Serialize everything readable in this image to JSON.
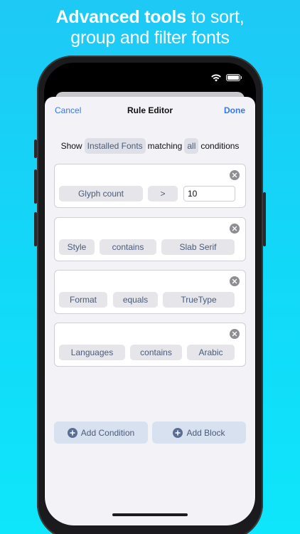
{
  "headline": {
    "bold": "Advanced tools",
    "rest_line1": " to sort,",
    "line2": "group and filter fonts"
  },
  "navbar": {
    "cancel": "Cancel",
    "title": "Rule Editor",
    "done": "Done"
  },
  "match": {
    "show": "Show",
    "scope": "Installed Fonts",
    "matching": "matching",
    "quantifier": "all",
    "conditions": "conditions"
  },
  "rules": [
    {
      "field": "Glyph count",
      "operator": ">",
      "value": "10"
    },
    {
      "field": "Style",
      "operator": "contains",
      "value": "Slab Serif"
    },
    {
      "field": "Format",
      "operator": "equals",
      "value": "TrueType"
    },
    {
      "field": "Languages",
      "operator": "contains",
      "value": "Arabic"
    }
  ],
  "actions": {
    "add_condition": "Add Condition",
    "add_block": "Add Block"
  },
  "icons": {
    "wifi": "wifi-icon",
    "battery": "battery-icon",
    "remove": "close-circle-icon",
    "add": "plus-circle-icon"
  },
  "colors": {
    "background_top": "#1ec9f5",
    "background_bottom": "#0ee6fb",
    "accent": "#3478f6",
    "pill_text": "#4a5b7c"
  }
}
